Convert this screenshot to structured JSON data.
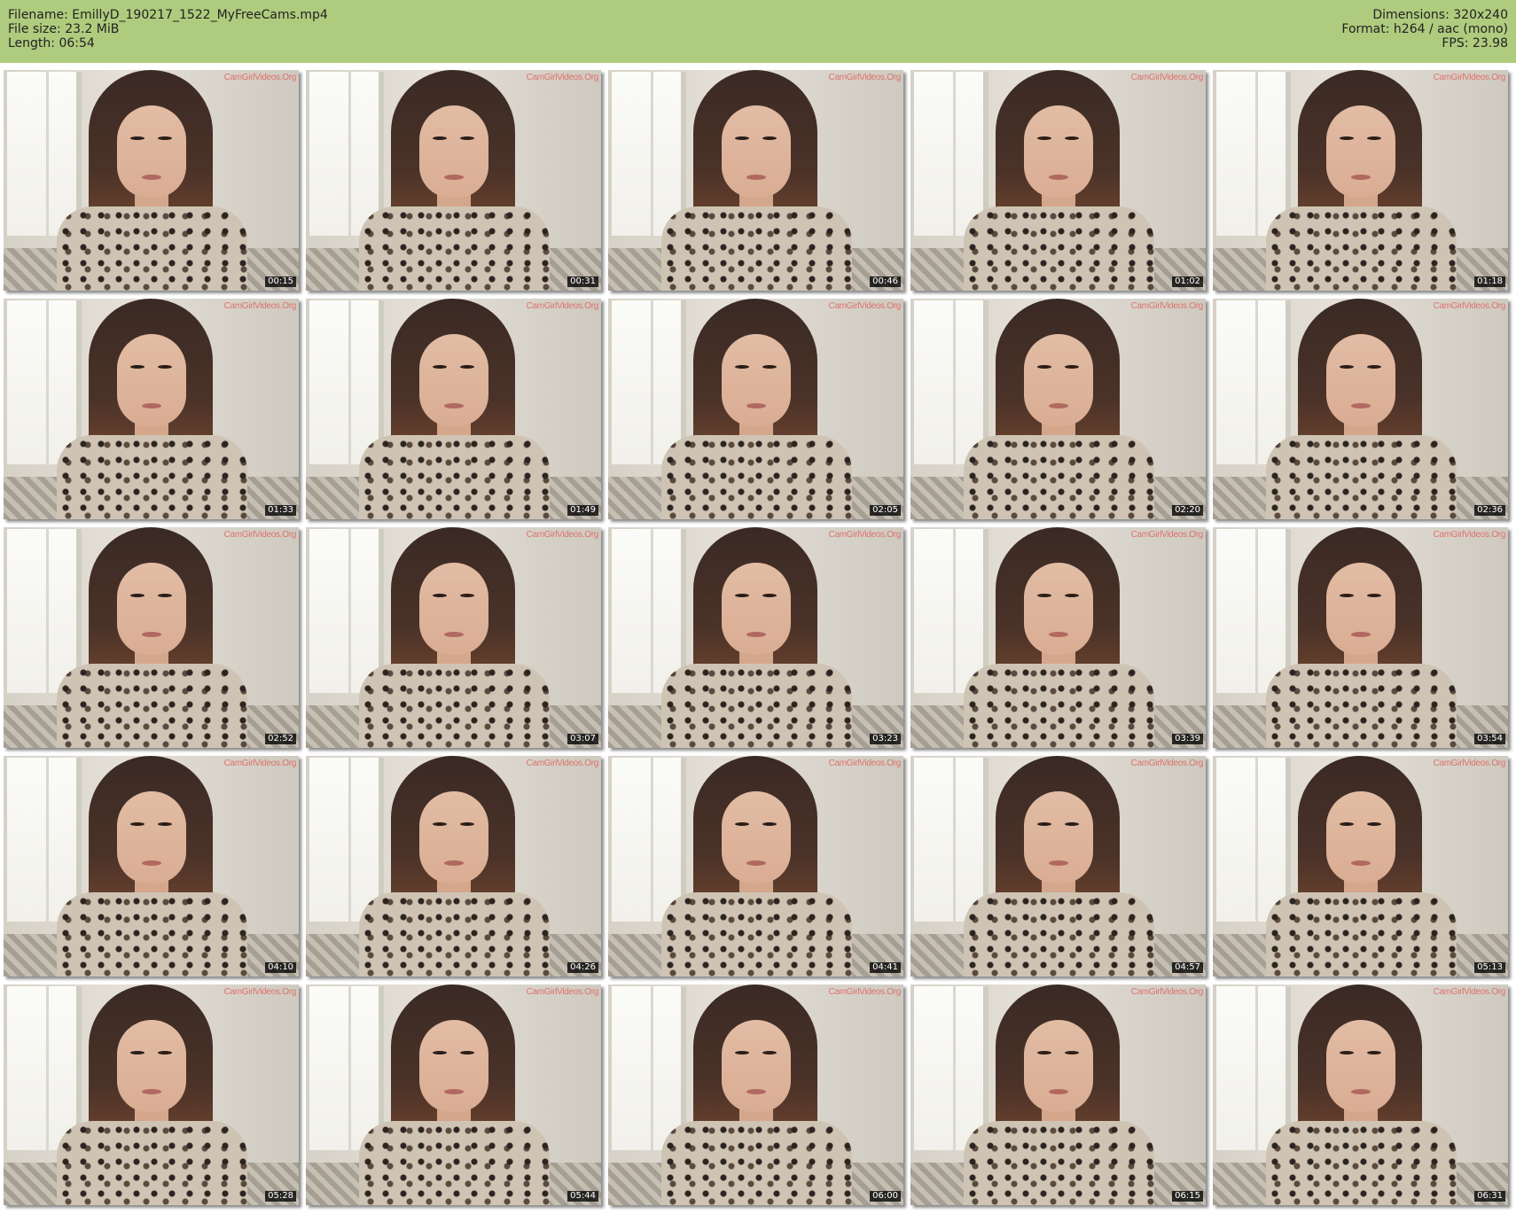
{
  "header": {
    "filename_label": "Filename: EmillyD_190217_1522_MyFreeCams.mp4",
    "filesize_label": "File size: 23.2 MiB",
    "length_label": "Length: 06:54",
    "dimensions_label": "Dimensions: 320x240",
    "format_label": "Format: h264 / aac (mono)",
    "fps_label": "FPS: 23.98",
    "background_color": "#afcb7d"
  },
  "thumbnails": [
    {
      "timestamp": "00:15",
      "watermark": "CamGirlVideos.Org"
    },
    {
      "timestamp": "00:31",
      "watermark": "CamGirlVideos.Org"
    },
    {
      "timestamp": "00:46",
      "watermark": "CamGirlVideos.Org"
    },
    {
      "timestamp": "01:02",
      "watermark": "CamGirlVideos.Org"
    },
    {
      "timestamp": "01:18",
      "watermark": "CamGirlVideos.Org"
    },
    {
      "timestamp": "01:33",
      "watermark": "CamGirlVideos.Org"
    },
    {
      "timestamp": "01:49",
      "watermark": "CamGirlVideos.Org"
    },
    {
      "timestamp": "02:05",
      "watermark": "CamGirlVideos.Org"
    },
    {
      "timestamp": "02:20",
      "watermark": "CamGirlVideos.Org"
    },
    {
      "timestamp": "02:36",
      "watermark": "CamGirlVideos.Org"
    },
    {
      "timestamp": "02:52",
      "watermark": "CamGirlVideos.Org"
    },
    {
      "timestamp": "03:07",
      "watermark": "CamGirlVideos.Org"
    },
    {
      "timestamp": "03:23",
      "watermark": "CamGirlVideos.Org"
    },
    {
      "timestamp": "03:39",
      "watermark": "CamGirlVideos.Org"
    },
    {
      "timestamp": "03:54",
      "watermark": "CamGirlVideos.Org"
    },
    {
      "timestamp": "04:10",
      "watermark": "CamGirlVideos.Org"
    },
    {
      "timestamp": "04:26",
      "watermark": "CamGirlVideos.Org"
    },
    {
      "timestamp": "04:41",
      "watermark": "CamGirlVideos.Org"
    },
    {
      "timestamp": "04:57",
      "watermark": "CamGirlVideos.Org"
    },
    {
      "timestamp": "05:13",
      "watermark": "CamGirlVideos.Org"
    },
    {
      "timestamp": "05:28",
      "watermark": "CamGirlVideos.Org"
    },
    {
      "timestamp": "05:44",
      "watermark": "CamGirlVideos.Org"
    },
    {
      "timestamp": "06:00",
      "watermark": "CamGirlVideos.Org"
    },
    {
      "timestamp": "06:15",
      "watermark": "CamGirlVideos.Org"
    },
    {
      "timestamp": "06:31",
      "watermark": "CamGirlVideos.Org"
    }
  ]
}
